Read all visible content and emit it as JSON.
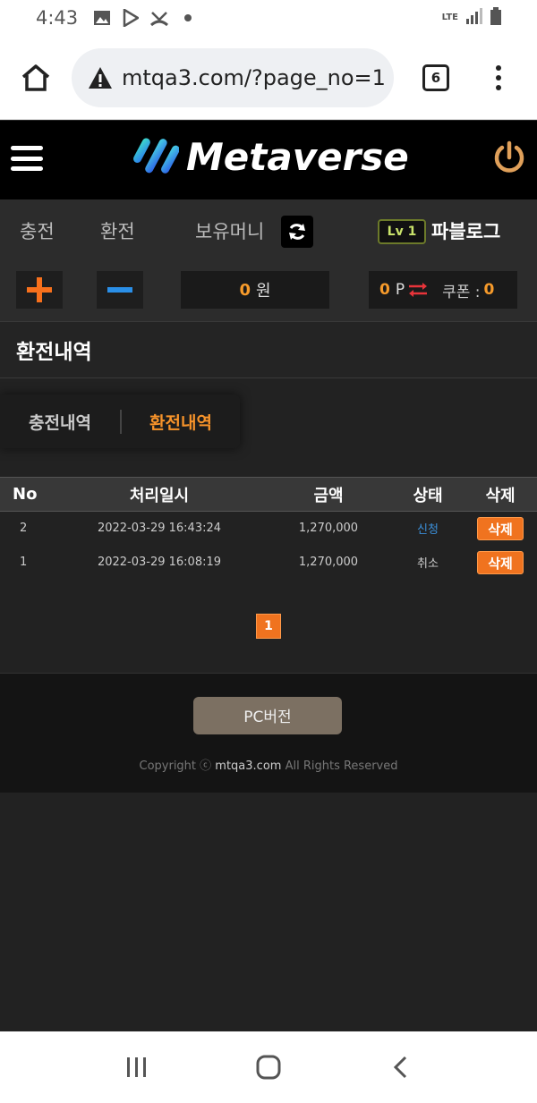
{
  "statusbar": {
    "time": "4:43",
    "network": "LTE"
  },
  "browser": {
    "url": "mtqa3.com/?page_no=1",
    "tab_count": "6"
  },
  "header": {
    "logo_text": "Metaverse"
  },
  "userbar": {
    "charge_label": "충전",
    "exchange_label": "환전",
    "holding_label": "보유머니",
    "level": "Lv 1",
    "username": "파블로그",
    "money_value": "0",
    "money_unit": "원",
    "point_value": "0",
    "point_unit": "P",
    "coupon_label": "쿠폰 :",
    "coupon_value": "0"
  },
  "section": {
    "title": "환전내역"
  },
  "subtabs": [
    {
      "label": "충전내역",
      "active": false
    },
    {
      "label": "환전내역",
      "active": true
    }
  ],
  "table": {
    "headers": [
      "No",
      "처리일시",
      "금액",
      "상태",
      "삭제"
    ],
    "rows": [
      {
        "no": "2",
        "date": "2022-03-29 16:43:24",
        "amount": "1,270,000",
        "status": "신청",
        "delete": "삭제"
      },
      {
        "no": "1",
        "date": "2022-03-29 16:08:19",
        "amount": "1,270,000",
        "status": "취소",
        "delete": "삭제"
      }
    ]
  },
  "pagination": {
    "current": "1"
  },
  "footer": {
    "pc_button": "PC버전",
    "copyright_prefix": "Copyright ⓒ",
    "copyright_domain": "mtqa3.com",
    "copyright_suffix": "All Rights Reserved"
  },
  "colors": {
    "accent": "#f0731f",
    "status_blue": "#3b8fd9",
    "level_green": "#c9e36b"
  }
}
